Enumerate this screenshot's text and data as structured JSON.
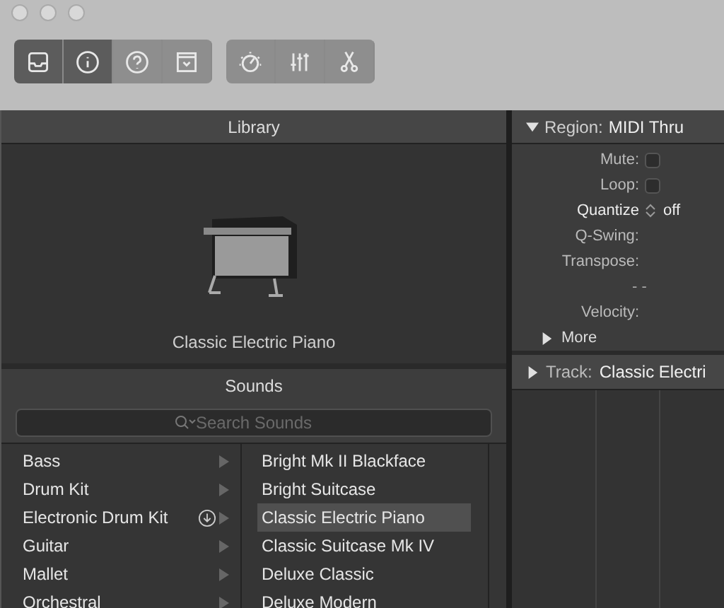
{
  "toolbar": {
    "groups": [
      [
        {
          "selected": true
        },
        {
          "selected": true
        },
        {
          "selected": false
        },
        {
          "selected": false
        }
      ],
      [
        {
          "selected": false
        },
        {
          "selected": false
        },
        {
          "selected": false
        }
      ]
    ]
  },
  "library": {
    "title": "Library",
    "patch_name": "Classic Electric Piano",
    "sounds_title": "Sounds",
    "search": {
      "placeholder": "Search Sounds"
    },
    "categories": [
      {
        "label": "Bass",
        "download": false
      },
      {
        "label": "Drum Kit",
        "download": false
      },
      {
        "label": "Electronic Drum Kit",
        "download": true
      },
      {
        "label": "Guitar",
        "download": false
      },
      {
        "label": "Mallet",
        "download": false
      },
      {
        "label": "Orchestral",
        "download": false
      }
    ],
    "patches": [
      {
        "label": "Bright Mk II Blackface",
        "selected": false
      },
      {
        "label": "Bright Suitcase",
        "selected": false
      },
      {
        "label": "Classic Electric Piano",
        "selected": true
      },
      {
        "label": "Classic Suitcase Mk IV",
        "selected": false
      },
      {
        "label": "Deluxe Classic",
        "selected": false
      },
      {
        "label": "Deluxe Modern",
        "selected": false
      }
    ]
  },
  "inspector": {
    "region": {
      "label": "Region:",
      "value": "MIDI Thru",
      "expanded": true
    },
    "rows": [
      {
        "kind": "checkbox",
        "label": "Mute:",
        "checked": false
      },
      {
        "kind": "checkbox",
        "label": "Loop:",
        "checked": false
      },
      {
        "kind": "popup",
        "label": "Quantize",
        "value": "off"
      },
      {
        "kind": "field",
        "label": "Q-Swing:"
      },
      {
        "kind": "field",
        "label": "Transpose:"
      },
      {
        "kind": "dash",
        "value": "- -"
      },
      {
        "kind": "field",
        "label": "Velocity:"
      }
    ],
    "more": {
      "label": "More",
      "expanded": false
    },
    "track": {
      "label": "Track:",
      "value": "Classic Electri",
      "expanded": false
    }
  }
}
